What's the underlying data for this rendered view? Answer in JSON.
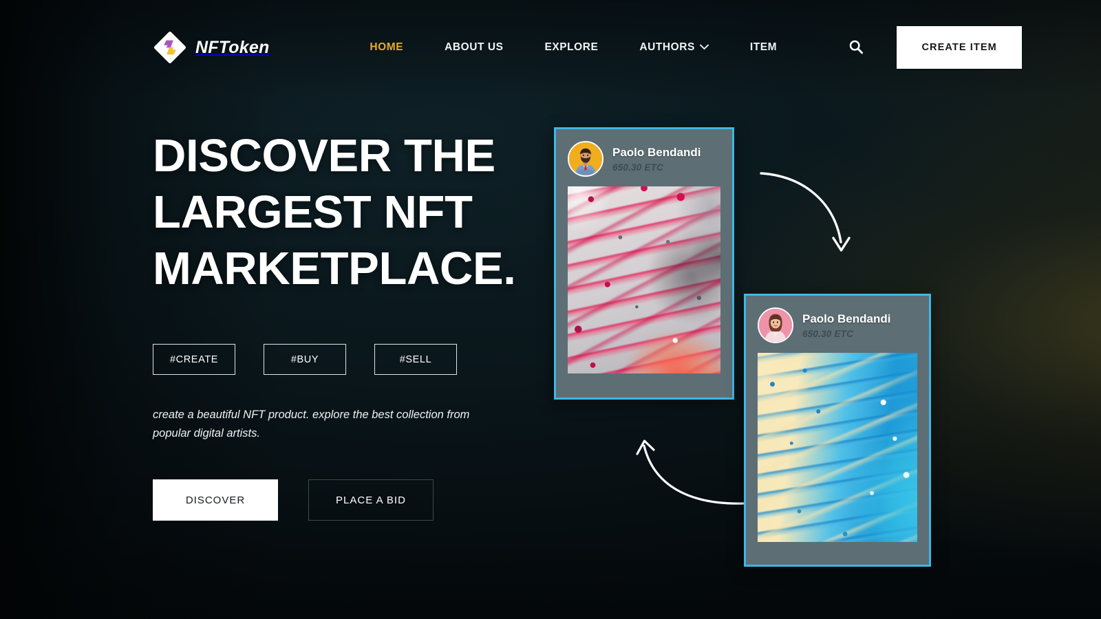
{
  "brand": {
    "name": "NFToken",
    "logo_icon": "diamond-bolt-logo-icon",
    "logo_colors": {
      "diamond": "#ffffff",
      "bolt_top": "#a855c4",
      "bolt_bottom": "#f2c230"
    }
  },
  "header": {
    "nav": [
      {
        "label": "HOME",
        "active": true,
        "has_chevron": false
      },
      {
        "label": "ABOUT US",
        "active": false,
        "has_chevron": false
      },
      {
        "label": "EXPLORE",
        "active": false,
        "has_chevron": false
      },
      {
        "label": "AUTHORS",
        "active": false,
        "has_chevron": true
      },
      {
        "label": "ITEM",
        "active": false,
        "has_chevron": false
      }
    ],
    "active_color": "#e4ac2a",
    "search_icon": "search-icon",
    "chevron_icon": "chevron-down-icon",
    "cta_label": "CREATE ITEM"
  },
  "hero": {
    "headline": "DISCOVER THE LARGEST NFT MARKETPLACE.",
    "tags": [
      "#CREATE",
      "#BUY",
      "#SELL"
    ],
    "description": "create a beautiful NFT product. explore the best collection from popular digital artists.",
    "primary_cta": "DISCOVER",
    "secondary_cta": "PLACE A BID"
  },
  "cards": [
    {
      "author": "Paolo Bendandi",
      "price": "650.30 ETC",
      "avatar_icon": "avatar-male",
      "avatar_bg": "#f0ad1e",
      "artwork_name": "red-pink-fluid-marble-art",
      "border_color": "#3fb6e6",
      "frame_color": "#5d6e75"
    },
    {
      "author": "Paolo Bendandi",
      "price": "650.30 ETC",
      "avatar_icon": "avatar-female",
      "avatar_bg": "#ef93a8",
      "artwork_name": "blue-cream-fluid-marble-art",
      "border_color": "#3fb6e6",
      "frame_color": "#5d6e75"
    }
  ],
  "decorations": {
    "arrow_top": "curved-arrow-down-right-icon",
    "arrow_bottom": "curved-arrow-up-left-icon",
    "arrow_color": "#ffffff"
  },
  "theme": {
    "background_dark": "#060a0c",
    "background_teal": "#0e2026",
    "text_primary": "#ffffff",
    "accent_gold": "#e4ac2a",
    "accent_cyan": "#3fb6e6",
    "button_light": "#ffffff"
  }
}
